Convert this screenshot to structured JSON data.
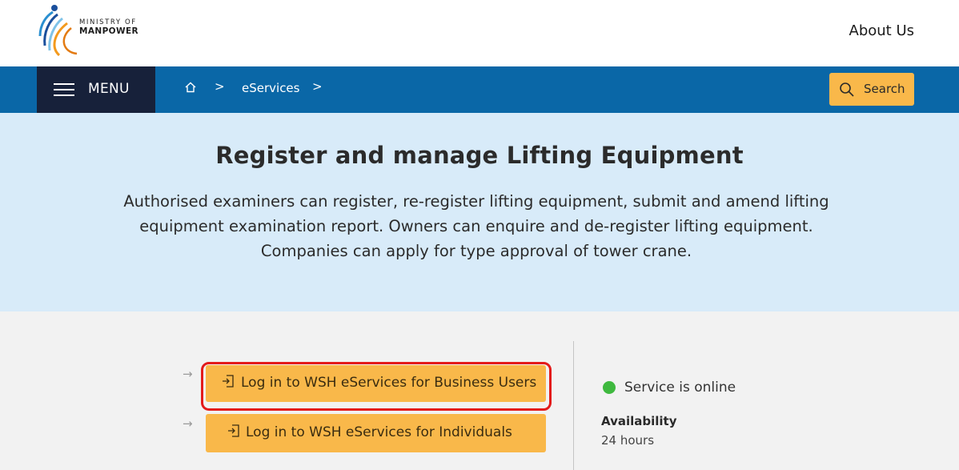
{
  "header": {
    "logo_line1": "MINISTRY OF",
    "logo_line2": "MANPOWER",
    "about_label": "About Us"
  },
  "nav": {
    "menu_label": "MENU",
    "breadcrumb_home_icon": "home-icon",
    "breadcrumb_sep": ">",
    "breadcrumb_item": "eServices",
    "search_label": "Search"
  },
  "hero": {
    "title": "Register and manage Lifting Equipment",
    "description": "Authorised examiners can register, re-register lifting equipment, submit and amend lifting equipment examination report. Owners can enquire and de-register lifting equipment. Companies can apply for type approval of tower crane."
  },
  "login": {
    "business_label": "Log in to WSH eServices for Business Users",
    "individual_label": "Log in to WSH eServices for Individuals",
    "arrow": "→"
  },
  "status": {
    "online_label": "Service is online",
    "availability_heading": "Availability",
    "availability_value": "24 hours"
  },
  "colors": {
    "nav_blue": "#0a67a7",
    "menu_navy": "#17213a",
    "accent_orange": "#f9b84a",
    "hero_bg": "#d8ebf9",
    "status_green": "#3fb93f",
    "highlight_red": "#e31b1b"
  }
}
